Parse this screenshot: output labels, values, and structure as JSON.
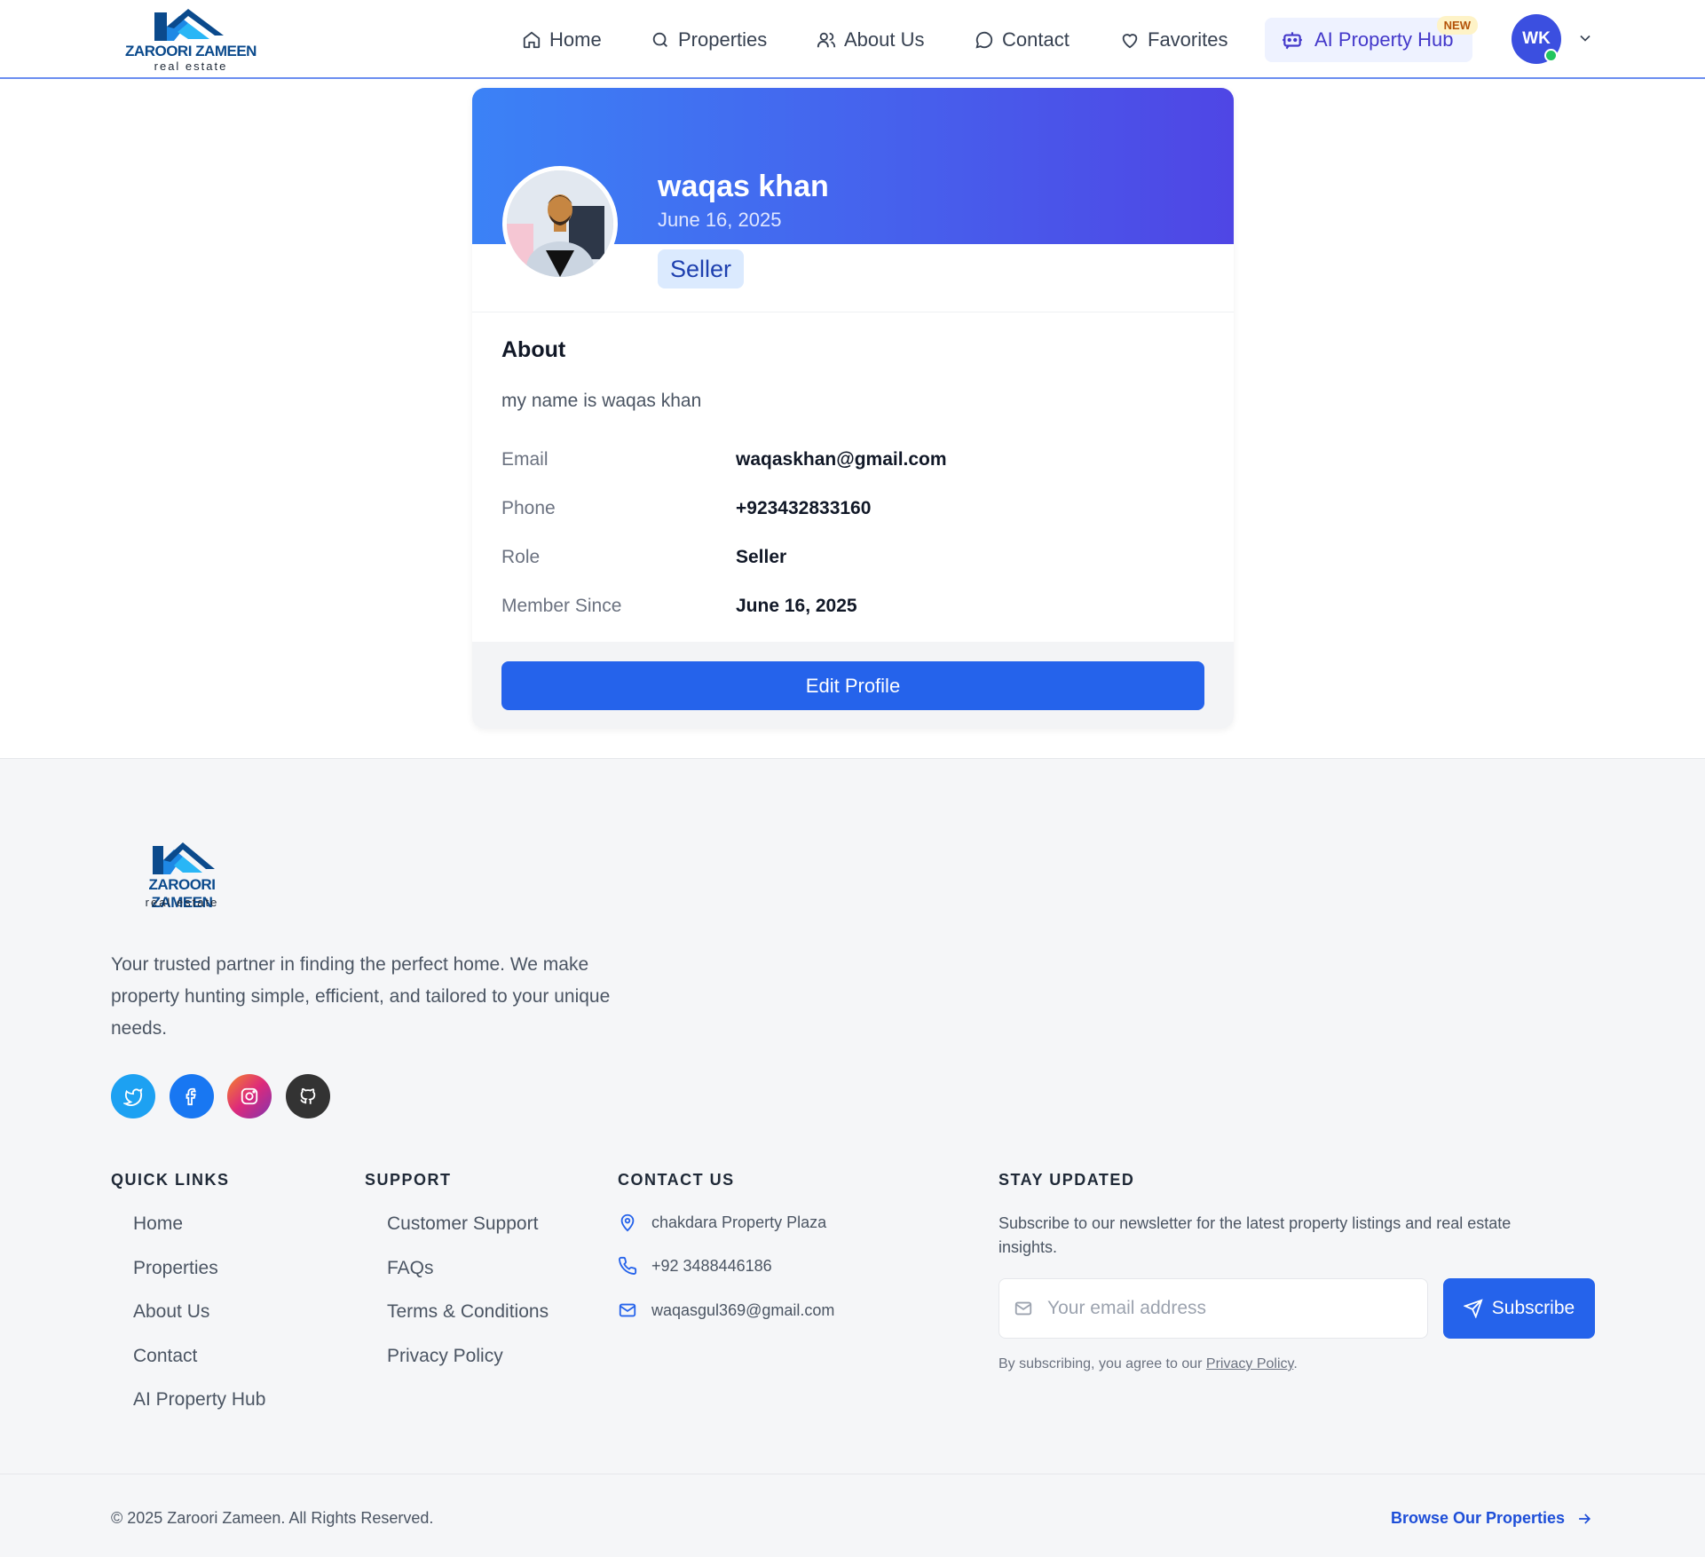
{
  "brand": {
    "name": "ZAROORI ZAMEEN",
    "tagline": "real estate"
  },
  "nav": {
    "items": [
      {
        "label": "Home",
        "icon": "home-icon"
      },
      {
        "label": "Properties",
        "icon": "search-icon"
      },
      {
        "label": "About Us",
        "icon": "users-icon"
      },
      {
        "label": "Contact",
        "icon": "message-icon"
      },
      {
        "label": "Favorites",
        "icon": "heart-icon"
      }
    ],
    "ai_hub": {
      "label": "AI Property Hub",
      "badge": "NEW",
      "icon": "bot-icon"
    },
    "user_initials": "WK"
  },
  "profile": {
    "name": "waqas khan",
    "date": "June 16, 2025",
    "role_badge": "Seller",
    "about_title": "About",
    "about_text": "my name is waqas khan",
    "fields": [
      {
        "label": "Email",
        "value": "waqaskhan@gmail.com"
      },
      {
        "label": "Phone",
        "value": "+923432833160"
      },
      {
        "label": "Role",
        "value": "Seller"
      },
      {
        "label": "Member Since",
        "value": "June 16, 2025"
      }
    ],
    "edit_button": "Edit Profile"
  },
  "footer": {
    "description": "Your trusted partner in finding the perfect home. We make property hunting simple, efficient, and tailored to your unique needs.",
    "social": [
      {
        "name": "twitter-icon",
        "color": "#1da1f2"
      },
      {
        "name": "facebook-icon",
        "color": "#1877f2"
      },
      {
        "name": "instagram-icon",
        "color": "#e1306c"
      },
      {
        "name": "github-icon",
        "color": "#333333"
      }
    ],
    "quick_links": {
      "title": "QUICK LINKS",
      "items": [
        "Home",
        "Properties",
        "About Us",
        "Contact",
        "AI Property Hub"
      ]
    },
    "support": {
      "title": "SUPPORT",
      "items": [
        "Customer Support",
        "FAQs",
        "Terms & Conditions",
        "Privacy Policy"
      ]
    },
    "contact": {
      "title": "CONTACT US",
      "address": "chakdara Property Plaza",
      "phone": "+92 3488446186",
      "email": "waqasgul369@gmail.com"
    },
    "newsletter": {
      "title": "STAY UPDATED",
      "text": "Subscribe to our newsletter for the latest property listings and real estate insights.",
      "placeholder": "Your email address",
      "button": "Subscribe",
      "legal_prefix": "By subscribing, you agree to our",
      "legal_link": "Privacy Policy",
      "legal_suffix": "."
    },
    "copyright": "© 2025 Zaroori Zameen. All Rights Reserved.",
    "browse": "Browse Our Properties"
  }
}
